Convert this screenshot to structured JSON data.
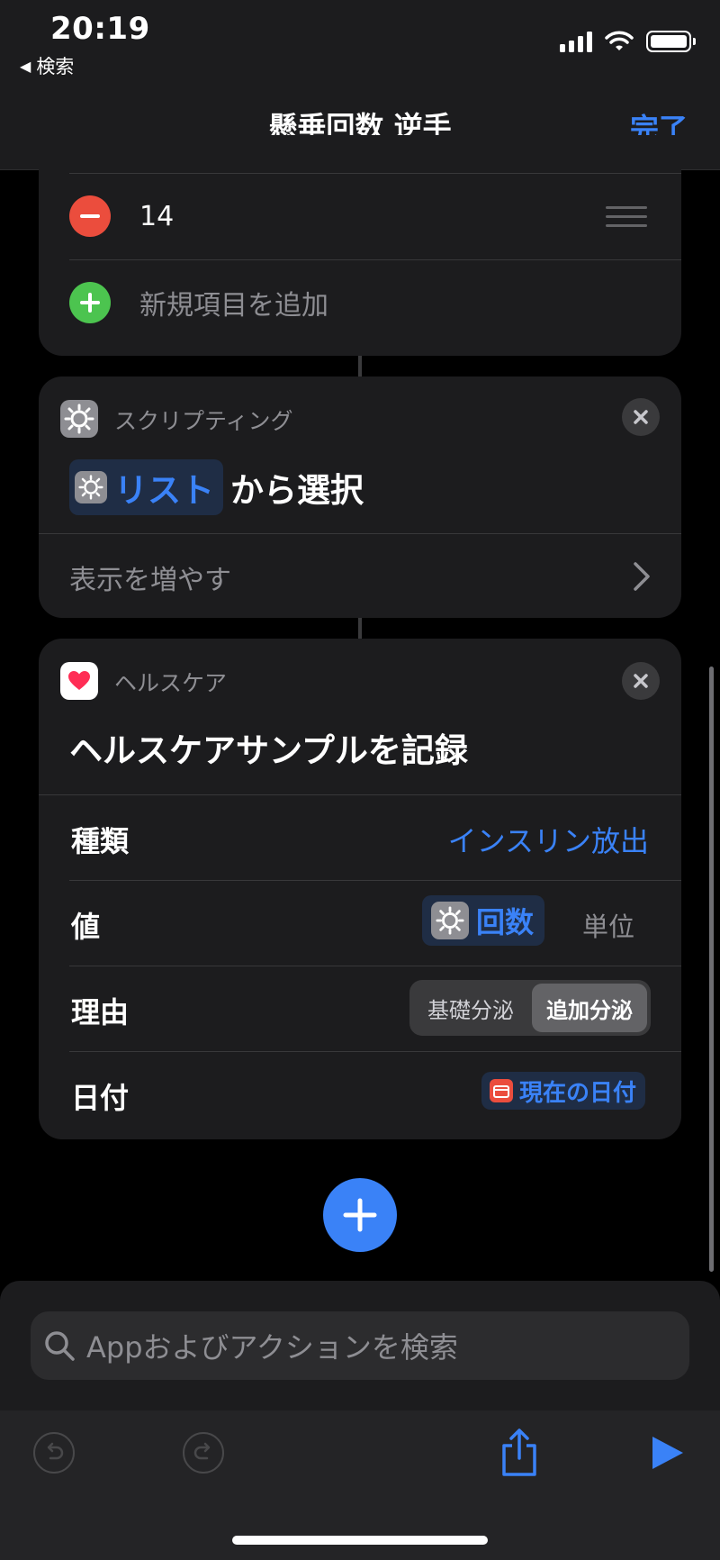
{
  "status_bar": {
    "time": "20:19",
    "back_label": "検索"
  },
  "nav": {
    "title": "懸垂回数 逆手",
    "done_label": "完了"
  },
  "list_card": {
    "item_value": "14",
    "add_item_label": "新規項目を追加"
  },
  "scripting_card": {
    "category": "スクリプティング",
    "token_label": "リスト",
    "action_suffix": "から選択",
    "show_more_label": "表示を増やす"
  },
  "health_card": {
    "category": "ヘルスケア",
    "title": "ヘルスケアサンプルを記録",
    "params": {
      "type_label": "種類",
      "type_value": "インスリン放出",
      "value_label": "値",
      "value_token": "回数",
      "unit_label": "単位",
      "reason_label": "理由",
      "reason_options": [
        "基礎分泌",
        "追加分泌"
      ],
      "reason_selected": "追加分泌",
      "date_label": "日付",
      "date_token": "現在の日付"
    }
  },
  "search": {
    "placeholder": "Appおよびアクションを検索"
  },
  "colors": {
    "accent": "#3a82f7",
    "remove": "#eb4d3d",
    "add": "#4cc44f",
    "card": "#1c1c1e"
  },
  "icons": [
    "back-triangle-icon",
    "signal-icon",
    "wifi-icon",
    "battery-icon",
    "remove-icon",
    "drag-handle-icon",
    "add-icon",
    "gear-icon",
    "close-icon",
    "chevron-right-icon",
    "heart-icon",
    "calendar-icon",
    "plus-icon",
    "search-icon",
    "undo-icon",
    "redo-icon",
    "share-icon",
    "play-icon"
  ]
}
